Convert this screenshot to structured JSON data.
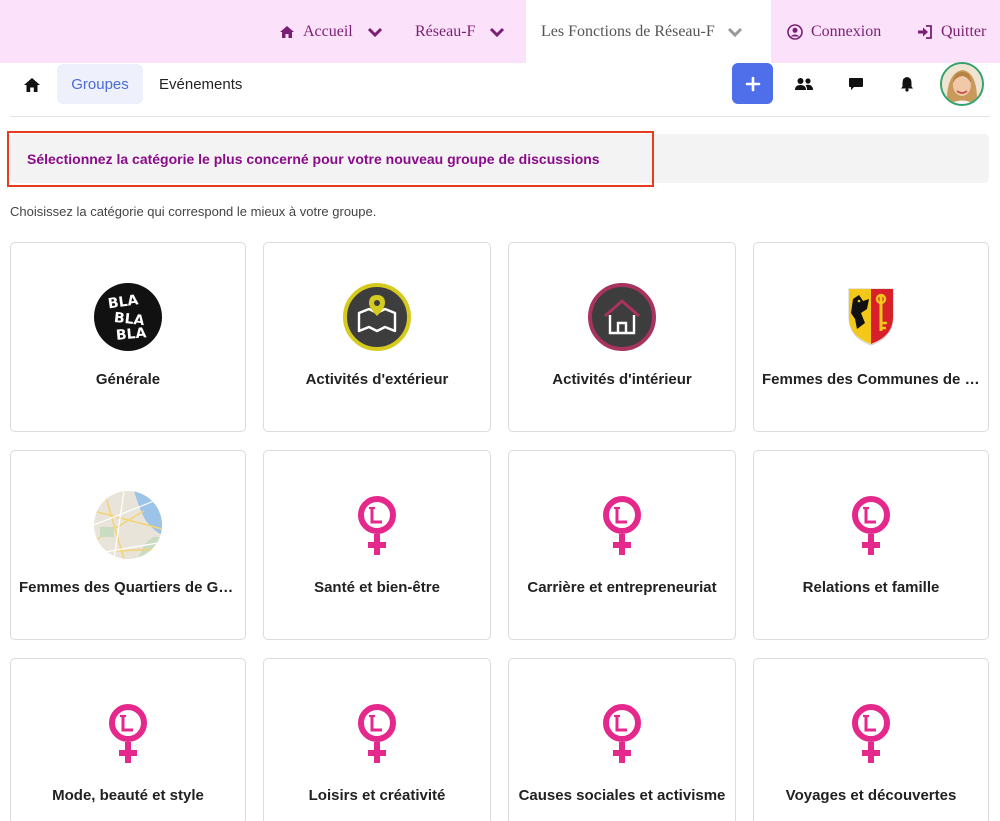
{
  "topnav": {
    "home_label": "Accueil",
    "network_label": "Réseau-F",
    "functions_label": "Les Fonctions de Réseau-F",
    "login_label": "Connexion",
    "quit_label": "Quitter"
  },
  "subnav": {
    "groups_tab": "Groupes",
    "events_tab": "Evénements"
  },
  "banner": {
    "text": "Sélectionnez la catégorie le plus concerné pour votre nouveau groupe de discussions"
  },
  "hint": "Choisissez la catégorie qui correspond le mieux à votre groupe.",
  "logo_blabla": [
    "BLA",
    "BLA",
    "BLA"
  ],
  "categories": [
    {
      "label": "Générale",
      "icon": "blabla-icon"
    },
    {
      "label": "Activités d'extérieur",
      "icon": "map-pin-icon"
    },
    {
      "label": "Activités d'intérieur",
      "icon": "house-icon"
    },
    {
      "label": "Femmes des Communes de Genève",
      "icon": "geneva-coat-of-arms-icon"
    },
    {
      "label": "Femmes des Quartiers de Genève",
      "icon": "map-icon"
    },
    {
      "label": "Santé et bien-être",
      "icon": "venus-l-icon"
    },
    {
      "label": "Carrière et entrepreneuriat",
      "icon": "venus-l-icon"
    },
    {
      "label": "Relations et famille",
      "icon": "venus-l-icon"
    },
    {
      "label": "Mode, beauté et style",
      "icon": "venus-l-icon"
    },
    {
      "label": "Loisirs et créativité",
      "icon": "venus-l-icon"
    },
    {
      "label": "Causes sociales et activisme",
      "icon": "venus-l-icon"
    },
    {
      "label": "Voyages et découvertes",
      "icon": "venus-l-icon"
    }
  ],
  "colors": {
    "nav_bg": "#fce1fb",
    "nav_text": "#7a1f74",
    "accent": "#4f6ee9",
    "banner_text": "#8a0b8a",
    "highlight_border": "#e53b1e",
    "venus_pink": "#e5288c"
  }
}
